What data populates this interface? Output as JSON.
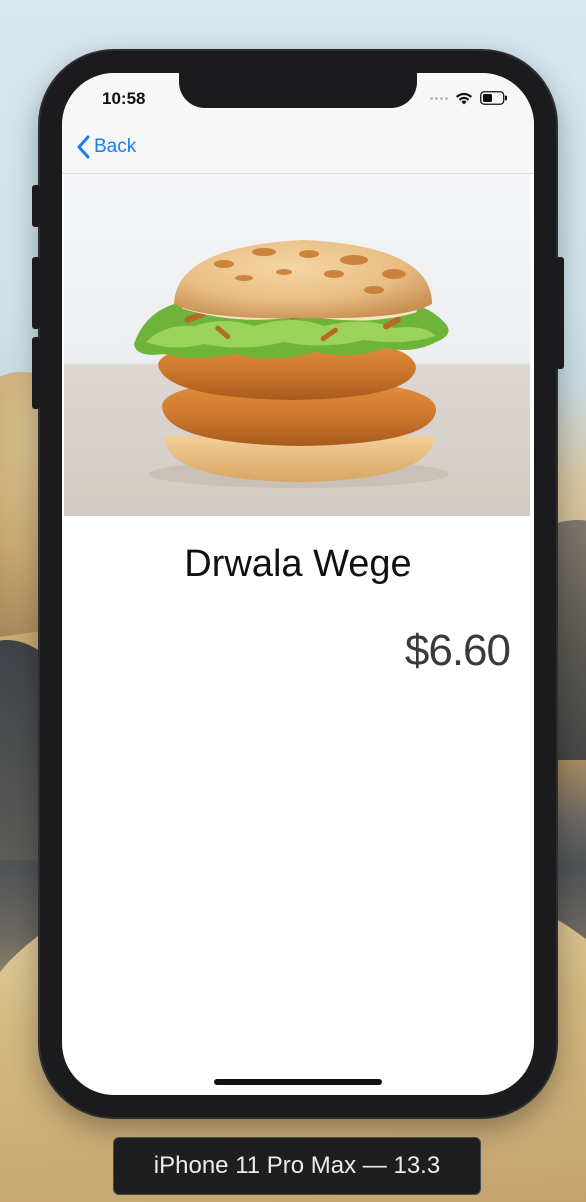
{
  "status_bar": {
    "time": "10:58",
    "icons": [
      "signal-dots-icon",
      "wifi-icon",
      "battery-icon"
    ]
  },
  "nav": {
    "back_label": "Back",
    "back_icon": "chevron-left-icon"
  },
  "product": {
    "image_subject": "burger-photo",
    "name": "Drwala Wege",
    "price": "$6.60"
  },
  "simulator": {
    "device_label": "iPhone 11 Pro Max — 13.3"
  },
  "colors": {
    "accent": "#1a7cf2",
    "screen_bg": "#ffffff",
    "bar_bg": "#f7f7f7",
    "bezel": "#1b1b1d"
  }
}
